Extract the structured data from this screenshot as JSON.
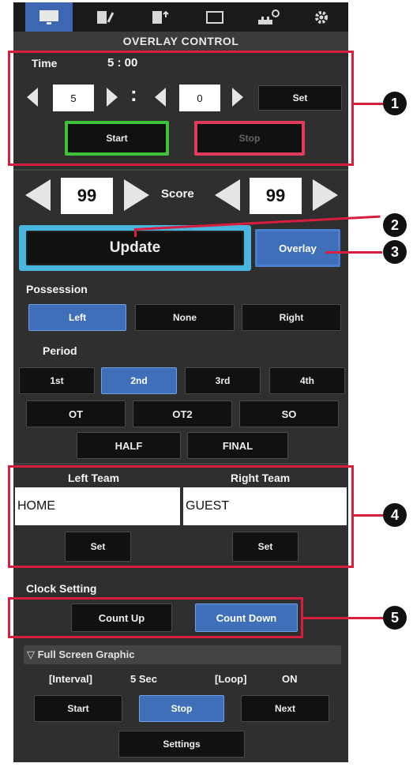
{
  "header": {
    "title": "OVERLAY CONTROL",
    "tabs": [
      {
        "icon": "monitor-icon",
        "active": true
      },
      {
        "icon": "document-edit-icon",
        "active": false
      },
      {
        "icon": "document-upload-icon",
        "active": false
      },
      {
        "icon": "screen-icon",
        "active": false
      },
      {
        "icon": "network-gear-icon",
        "active": false
      },
      {
        "icon": "gear-icon",
        "active": false
      }
    ]
  },
  "time": {
    "label": "Time",
    "display": "5 : 00",
    "minutes_value": "5",
    "colon": ":",
    "seconds_value": "0",
    "set_label": "Set",
    "start_label": "Start",
    "stop_label": "Stop"
  },
  "score": {
    "label": "Score",
    "left_value": "99",
    "right_value": "99",
    "update_label": "Update",
    "overlay_label": "Overlay"
  },
  "possession": {
    "label": "Possession",
    "left_label": "Left",
    "none_label": "None",
    "right_label": "Right",
    "selected": "Left"
  },
  "period": {
    "label": "Period",
    "row1": [
      "1st",
      "2nd",
      "3rd",
      "4th"
    ],
    "row2": [
      "OT",
      "OT2",
      "SO"
    ],
    "row3": [
      "HALF",
      "FINAL"
    ],
    "selected": "2nd"
  },
  "teams": {
    "left_label": "Left Team",
    "right_label": "Right Team",
    "left_value": "HOME",
    "right_value": "GUEST",
    "set_label": "Set"
  },
  "clock": {
    "label": "Clock Setting",
    "count_up_label": "Count Up",
    "count_down_label": "Count Down",
    "selected": "Count Down"
  },
  "fullscreen": {
    "label": "▽ Full Screen Graphic",
    "interval_label": "[Interval]",
    "interval_value": "5 Sec",
    "loop_label": "[Loop]",
    "loop_value": "ON",
    "start_label": "Start",
    "stop_label": "Stop",
    "next_label": "Next",
    "settings_label": "Settings"
  },
  "callouts": [
    "1",
    "2",
    "3",
    "4",
    "5"
  ],
  "colors": {
    "panel": "#2f2f2f",
    "accent_blue": "#3f6fb8",
    "start_green": "#3fc23a",
    "stop_red": "#d81e3e",
    "update_cyan": "#49b6e0",
    "callout_red": "#d81e3e"
  }
}
